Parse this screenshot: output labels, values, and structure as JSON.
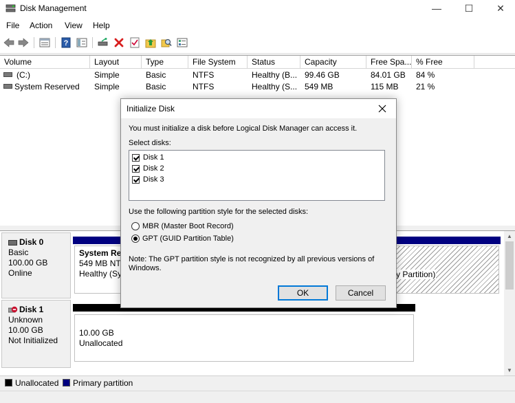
{
  "window": {
    "title": "Disk Management",
    "controls": {
      "minimize": "—",
      "maximize": "☐",
      "close": "✕"
    }
  },
  "menu": {
    "items": [
      "File",
      "Action",
      "View",
      "Help"
    ]
  },
  "toolbar": {
    "buttons": [
      "back-icon",
      "forward-icon",
      "properties-icon",
      "help-icon",
      "console-tree-icon",
      "connect-disk-icon",
      "delete-icon",
      "checklist-icon",
      "folder-up-icon",
      "search-folder-icon",
      "settings-list-icon"
    ]
  },
  "volume_table": {
    "columns": [
      "Volume",
      "Layout",
      "Type",
      "File System",
      "Status",
      "Capacity",
      "Free Spa...",
      "% Free"
    ],
    "rows": [
      {
        "volume": "(C:)",
        "layout": "Simple",
        "type": "Basic",
        "fs": "NTFS",
        "status": "Healthy (B...",
        "capacity": "99.46 GB",
        "free": "84.01 GB",
        "pct": "84 %"
      },
      {
        "volume": "System Reserved",
        "layout": "Simple",
        "type": "Basic",
        "fs": "NTFS",
        "status": "Healthy (S...",
        "capacity": "549 MB",
        "free": "115 MB",
        "pct": "21 %"
      }
    ]
  },
  "disks": {
    "disk0": {
      "name": "Disk 0",
      "kind": "Basic",
      "size": "100.00 GB",
      "state": "Online",
      "partition1": {
        "name": "System Res",
        "size": "549 MB NTF",
        "status": "Healthy (Sys"
      },
      "partition2": {
        "status": "y Partition)"
      }
    },
    "disk1": {
      "name": "Disk 1",
      "kind": "Unknown",
      "size": "10.00 GB",
      "state": "Not Initialized",
      "partition1": {
        "size": "10.00 GB",
        "status": "Unallocated"
      }
    }
  },
  "legend": {
    "unallocated": "Unallocated",
    "primary": "Primary partition"
  },
  "colors": {
    "primary": "#000080",
    "unallocated": "#000000",
    "accent": "#0078d7"
  },
  "dialog": {
    "title": "Initialize Disk",
    "intro": "You must initialize a disk before Logical Disk Manager can access it.",
    "select_label": "Select disks:",
    "disks": [
      "Disk 1",
      "Disk 2",
      "Disk 3"
    ],
    "partition_label": "Use the following partition style for the selected disks:",
    "mbr_label": "MBR (Master Boot Record)",
    "gpt_label": "GPT (GUID Partition Table)",
    "selected_style": "GPT",
    "note_line1": "Note: The GPT partition style is not recognized by all previous versions of",
    "note_line2": "Windows.",
    "ok_label": "OK",
    "cancel_label": "Cancel"
  }
}
